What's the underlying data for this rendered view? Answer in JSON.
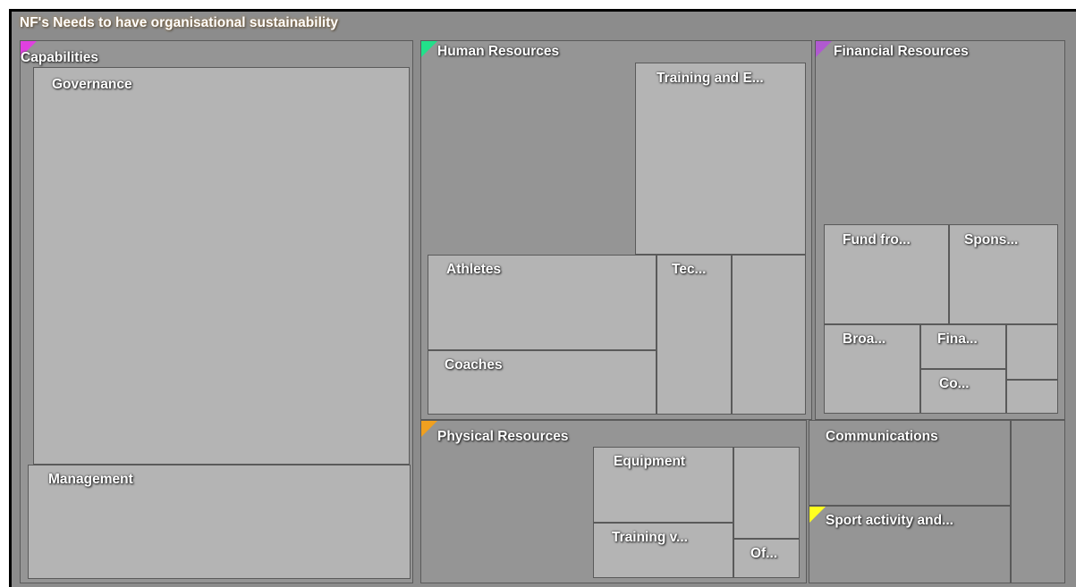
{
  "chart_data": {
    "type": "treemap",
    "title": "NF's Needs to have organisational sustainability",
    "colors": {
      "background": "#8c8c8c",
      "group": "#959595",
      "leaf": "#b4b4b4",
      "text": "#ffffff",
      "flag_capabilities": "#e040e0",
      "flag_human_resources": "#22e08a",
      "flag_financial_resources": "#b05ad0",
      "flag_physical_resources": "#f0a020",
      "flag_sport_activity": "#ffff20"
    },
    "nodes": [
      {
        "id": "capabilities",
        "label": "Capabilities",
        "level": 1,
        "flag": "flag_capabilities"
      },
      {
        "id": "governance",
        "label": "Governance",
        "level": 2
      },
      {
        "id": "management",
        "label": "Management",
        "level": 2
      },
      {
        "id": "human",
        "label": "Human Resources",
        "level": 1,
        "flag": "flag_human_resources"
      },
      {
        "id": "training-e",
        "label": "Training and E...",
        "level": 2
      },
      {
        "id": "athletes",
        "label": "Athletes",
        "level": 2
      },
      {
        "id": "coaches",
        "label": "Coaches",
        "level": 2
      },
      {
        "id": "tec",
        "label": "Tec...",
        "level": 2
      },
      {
        "id": "hr-unlabeled",
        "label": "",
        "level": 2
      },
      {
        "id": "financial",
        "label": "Financial Resources",
        "level": 1,
        "flag": "flag_financial_resources"
      },
      {
        "id": "fund",
        "label": "Fund fro...",
        "level": 2
      },
      {
        "id": "spons",
        "label": "Spons...",
        "level": 2
      },
      {
        "id": "broa",
        "label": "Broa...",
        "level": 2
      },
      {
        "id": "fina",
        "label": "Fina...",
        "level": 2
      },
      {
        "id": "co",
        "label": "Co...",
        "level": 2
      },
      {
        "id": "fin-small-1",
        "label": "",
        "level": 2
      },
      {
        "id": "fin-small-2",
        "label": "",
        "level": 2
      },
      {
        "id": "physical",
        "label": "Physical Resources",
        "level": 1,
        "flag": "flag_physical_resources"
      },
      {
        "id": "equipment",
        "label": "Equipment",
        "level": 2
      },
      {
        "id": "training-v",
        "label": "Training v...",
        "level": 2
      },
      {
        "id": "phys-unlabeled",
        "label": "",
        "level": 2
      },
      {
        "id": "of",
        "label": "Of...",
        "level": 2
      },
      {
        "id": "communications",
        "label": "Communications",
        "level": 1
      },
      {
        "id": "sport",
        "label": "Sport activity and...",
        "level": 1,
        "flag": "flag_sport_activity"
      },
      {
        "id": "right-strip",
        "label": "",
        "level": 1
      }
    ]
  }
}
